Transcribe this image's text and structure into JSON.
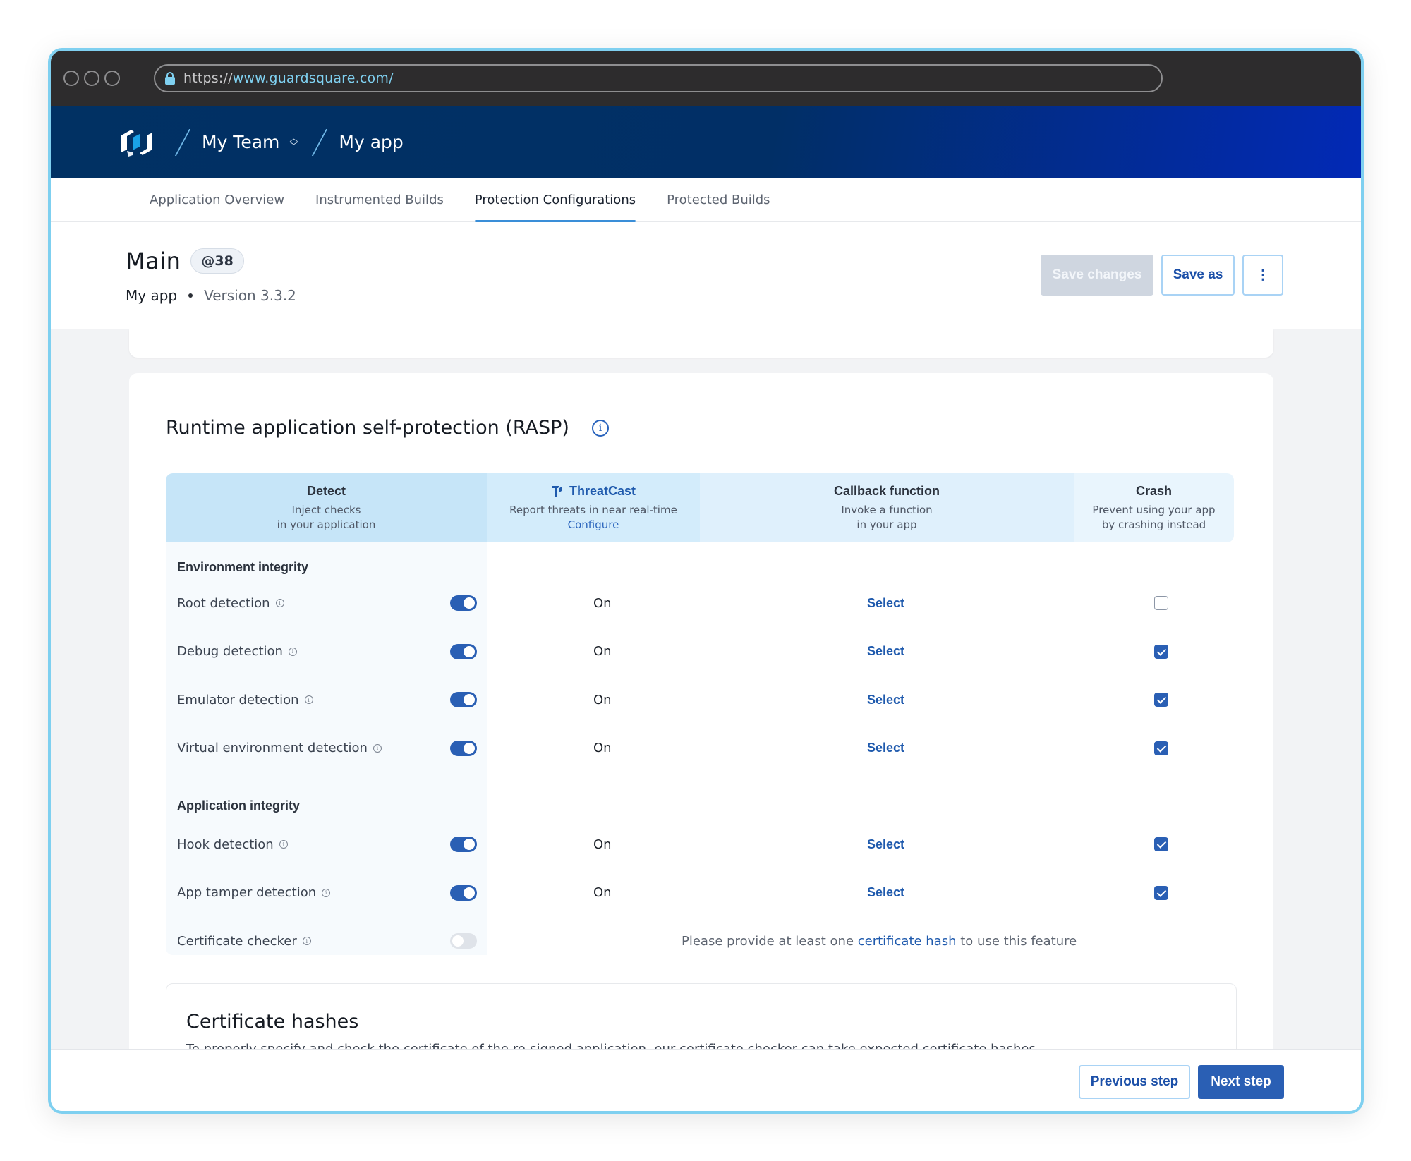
{
  "browser": {
    "url_scheme": "https://",
    "url_host": "www.guardsquare.com/",
    "lock_icon": "lock-icon"
  },
  "appbar": {
    "logo": "guardsquare-logo",
    "team": "My Team",
    "team_switcher_icon": "chevron-up-down-icon",
    "app": "My app"
  },
  "tabs": [
    {
      "label": "Application Overview",
      "active": false
    },
    {
      "label": "Instrumented Builds",
      "active": false
    },
    {
      "label": "Protection Configurations",
      "active": true
    },
    {
      "label": "Protected Builds",
      "active": false
    }
  ],
  "page_header": {
    "title": "Main",
    "badge": "@38",
    "app_name": "My app",
    "version": "Version 3.3.2",
    "save_changes": "Save changes",
    "save_as": "Save as",
    "more": "⋮"
  },
  "rasp": {
    "title": "Runtime application self-protection (RASP)",
    "info_icon": "info-icon",
    "columns": {
      "detect": {
        "title": "Detect",
        "sub1": "Inject checks",
        "sub2": "in your application"
      },
      "threatcast": {
        "title": "ThreatCast",
        "sub1": "Report threats in near real-time",
        "link": "Configure"
      },
      "callback": {
        "title": "Callback function",
        "sub1": "Invoke a function",
        "sub2": "in your app"
      },
      "crash": {
        "title": "Crash",
        "sub1": "Prevent using your app",
        "sub2": "by crashing instead"
      }
    },
    "groups": [
      {
        "name": "Environment integrity",
        "rows": [
          {
            "label": "Root detection",
            "enabled": true,
            "threatcast": "On",
            "callback": "Select",
            "crash": false
          },
          {
            "label": "Debug detection",
            "enabled": true,
            "threatcast": "On",
            "callback": "Select",
            "crash": true
          },
          {
            "label": "Emulator detection",
            "enabled": true,
            "threatcast": "On",
            "callback": "Select",
            "crash": true
          },
          {
            "label": "Virtual environment detection",
            "enabled": true,
            "threatcast": "On",
            "callback": "Select",
            "crash": true
          }
        ]
      },
      {
        "name": "Application integrity",
        "rows": [
          {
            "label": "Hook detection",
            "enabled": true,
            "threatcast": "On",
            "callback": "Select",
            "crash": true
          },
          {
            "label": "App tamper detection",
            "enabled": true,
            "threatcast": "On",
            "callback": "Select",
            "crash": true
          },
          {
            "label": "Certificate checker",
            "enabled": false
          }
        ]
      }
    ],
    "cert_notice": {
      "before": "Please provide at least one ",
      "link": "certificate hash",
      "after": " to use this feature"
    }
  },
  "certificate_hashes": {
    "title": "Certificate hashes",
    "description": "To properly specify and check the certificate of the re-signed application, our certificate checker can take expected certificate hashes."
  },
  "footer": {
    "previous": "Previous step",
    "next": "Next step"
  },
  "colors": {
    "primary": "#2a5fb4",
    "link": "#1f5aad",
    "window_border": "#7fd0f0",
    "header_start": "#013163",
    "header_end": "#0229b6"
  }
}
